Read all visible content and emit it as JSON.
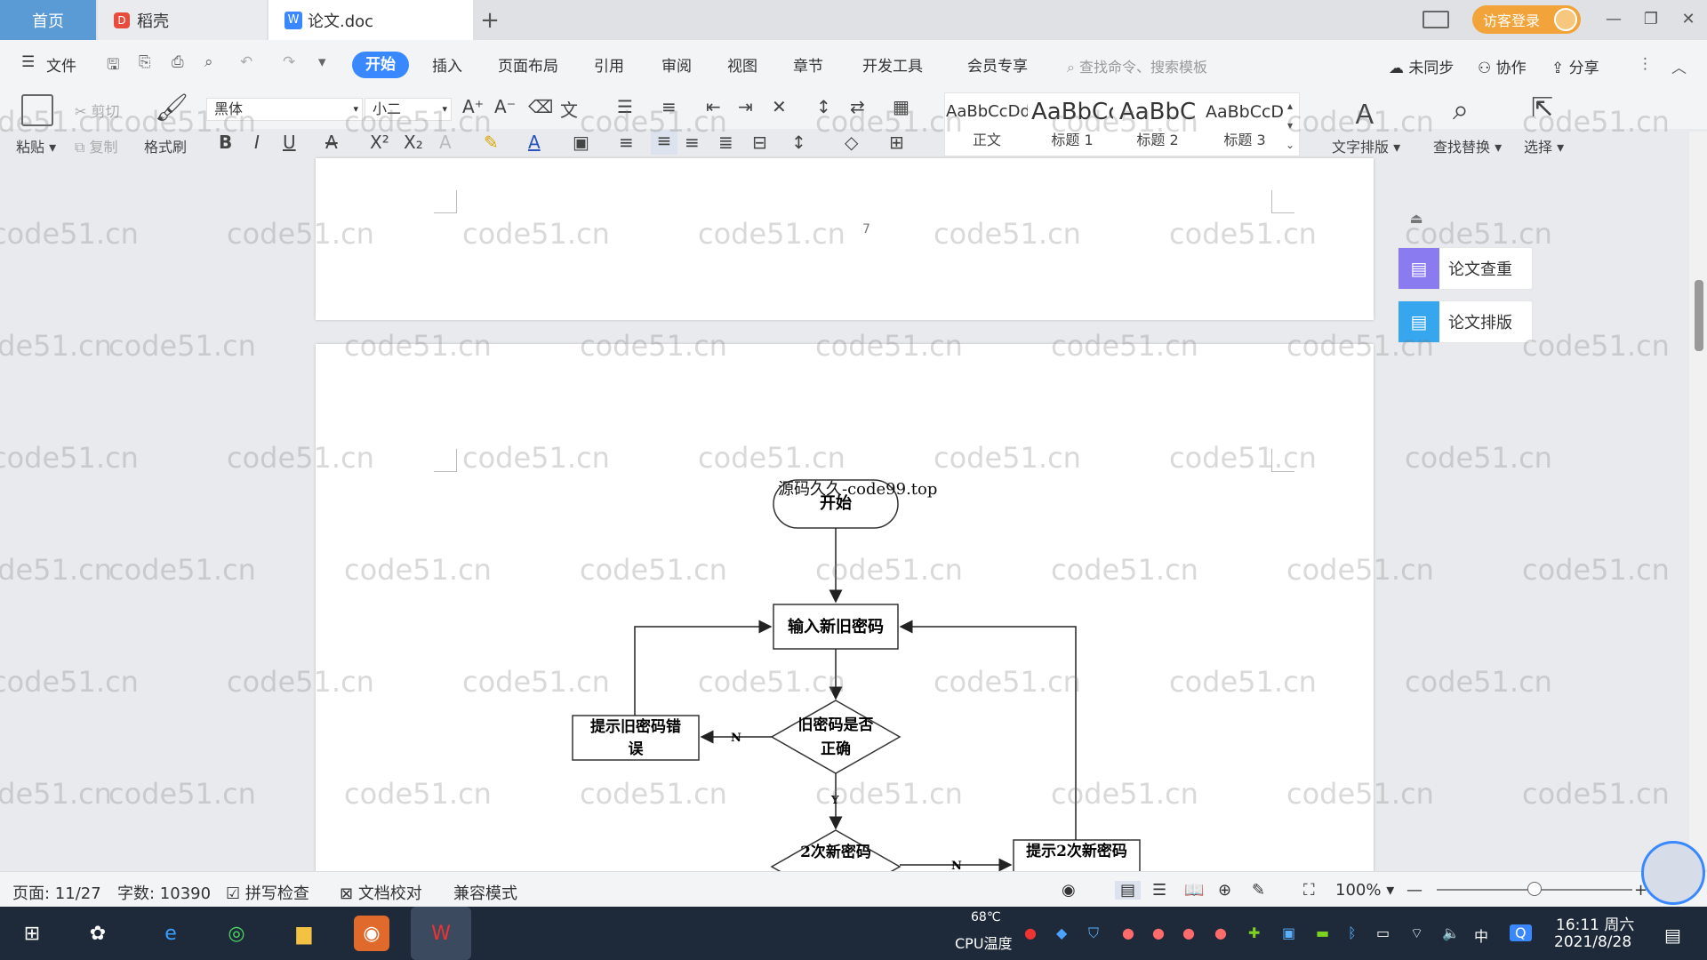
{
  "tabs": {
    "home": "首页",
    "daoke": "稻壳",
    "doc": "论文.doc",
    "add": "+"
  },
  "guest_login": "访客登录",
  "menu": {
    "file": "文件",
    "start": "开始",
    "insert": "插入",
    "layout": "页面布局",
    "reference": "引用",
    "review": "审阅",
    "view": "视图",
    "chapter": "章节",
    "devtools": "开发工具",
    "member": "会员专享",
    "search_placeholder": "查找命令、搜索模板",
    "unsync": "未同步",
    "collab": "协作",
    "share": "分享"
  },
  "toolbar": {
    "paste": "粘贴",
    "cut": "剪切",
    "copy": "复制",
    "format_painter": "格式刷",
    "font": "黑体",
    "size": "小二",
    "text_layout": "文字排版",
    "find_replace": "查找替换",
    "select": "选择"
  },
  "styles": [
    {
      "preview": "AaBbCcDd",
      "name": "正文"
    },
    {
      "preview": "AaBbCc",
      "name": "标题 1"
    },
    {
      "preview": "AaBbC",
      "name": "标题 2"
    },
    {
      "preview": "AaBbCcD",
      "name": "标题 3"
    }
  ],
  "page_number": "7",
  "watermark": "code51.cn",
  "right_panel": {
    "plagiarism": "论文查重",
    "formatting": "论文排版"
  },
  "flowchart": {
    "watermark_text": "源码久久-code99.top",
    "start": "开始",
    "input": "输入新旧密码",
    "check_line1": "旧密码是否",
    "check_line2": "正确",
    "error_line1": "提示旧密码错",
    "error_line2": "误",
    "n1": "N",
    "y1": "Y",
    "check2": "2次新密码",
    "n2": "N",
    "hint2": "提示2次新密码"
  },
  "status": {
    "page": "页面: 11/27",
    "words": "字数: 10390",
    "spell": "拼写检查",
    "proof": "文档校对",
    "compat": "兼容模式",
    "zoom": "100%",
    "zoom_level": 0.5
  },
  "taskbar": {
    "cpu_temp": "68℃",
    "cpu_label": "CPU温度",
    "time": "16:11 周六",
    "date": "2021/8/28",
    "ime": "中"
  }
}
